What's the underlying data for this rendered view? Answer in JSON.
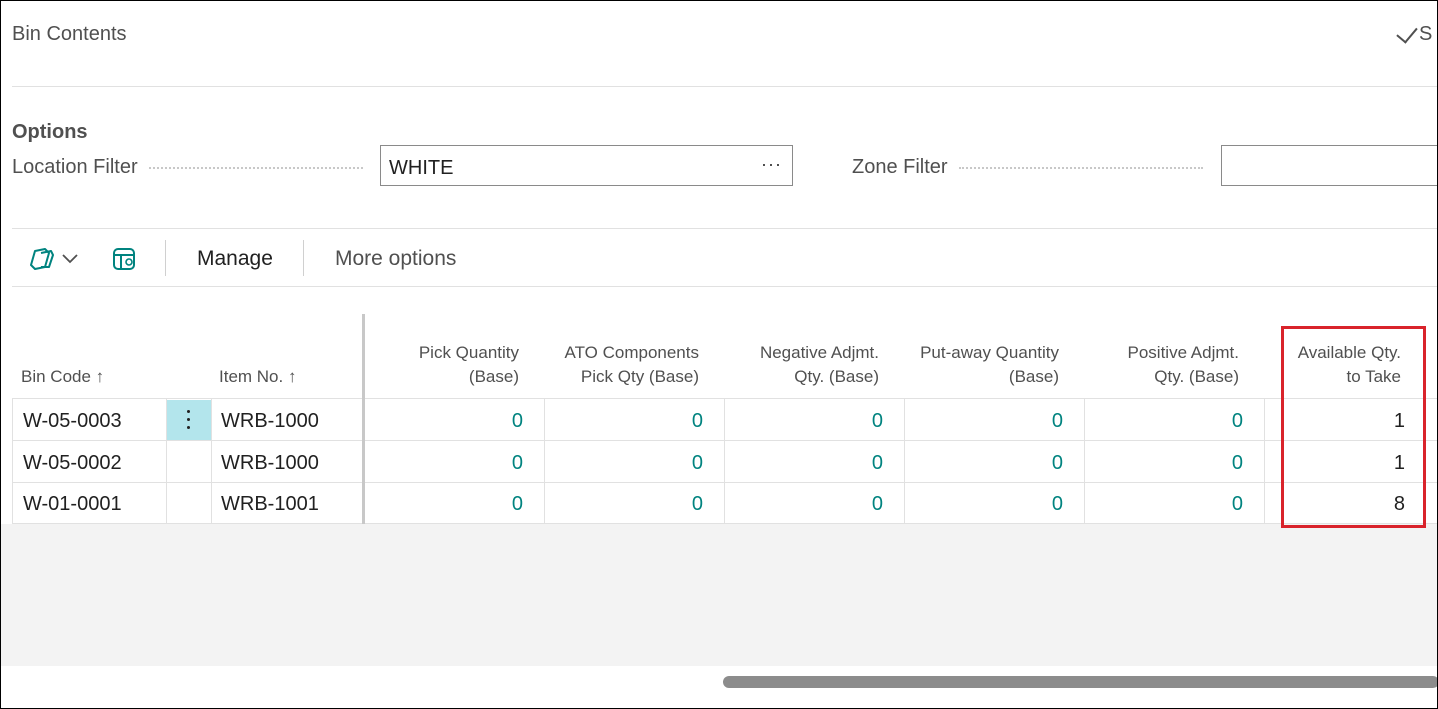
{
  "header": {
    "title": "Bin Contents",
    "save_status": "S"
  },
  "options": {
    "section_title": "Options",
    "location_filter": {
      "label": "Location Filter",
      "value": "WHITE",
      "assist": "···"
    },
    "zone_filter": {
      "label": "Zone Filter",
      "value": ""
    }
  },
  "toolbar": {
    "manage_label": "Manage",
    "more_options_label": "More options"
  },
  "table": {
    "columns": {
      "bin_code": {
        "label": "Bin Code",
        "sort": "↑"
      },
      "item_no": {
        "label": "Item No.",
        "sort": "↑"
      },
      "pick_qty": {
        "line1": "Pick Quantity",
        "line2": "(Base)"
      },
      "ato_pick_qty": {
        "line1": "ATO Components",
        "line2": "Pick Qty (Base)"
      },
      "neg_adjmt": {
        "line1": "Negative Adjmt.",
        "line2": "Qty. (Base)"
      },
      "putaway_qty": {
        "line1": "Put-away Quantity",
        "line2": "(Base)"
      },
      "pos_adjmt": {
        "line1": "Positive Adjmt.",
        "line2": "Qty. (Base)"
      },
      "avail_qty": {
        "line1": "Available Qty.",
        "line2": "to Take"
      }
    },
    "rows": [
      {
        "bin_code": "W-05-0003",
        "item_no": "WRB-1000",
        "pick_qty": "0",
        "ato_pick_qty": "0",
        "neg_adjmt": "0",
        "putaway_qty": "0",
        "pos_adjmt": "0",
        "avail_qty": "1"
      },
      {
        "bin_code": "W-05-0002",
        "item_no": "WRB-1000",
        "pick_qty": "0",
        "ato_pick_qty": "0",
        "neg_adjmt": "0",
        "putaway_qty": "0",
        "pos_adjmt": "0",
        "avail_qty": "1"
      },
      {
        "bin_code": "W-01-0001",
        "item_no": "WRB-1001",
        "pick_qty": "0",
        "ato_pick_qty": "0",
        "neg_adjmt": "0",
        "putaway_qty": "0",
        "pos_adjmt": "0",
        "avail_qty": "8"
      }
    ]
  },
  "colors": {
    "link_number": "#00837f",
    "selected_row_menu": "#b3e5ec",
    "highlight_box": "#d9232b"
  },
  "icons": {
    "copilot": "copilot-icon",
    "chevron": "chevron-down-icon",
    "layout": "layout-switch-icon",
    "row_menu": "vertical-ellipsis-icon",
    "save": "check-icon"
  }
}
